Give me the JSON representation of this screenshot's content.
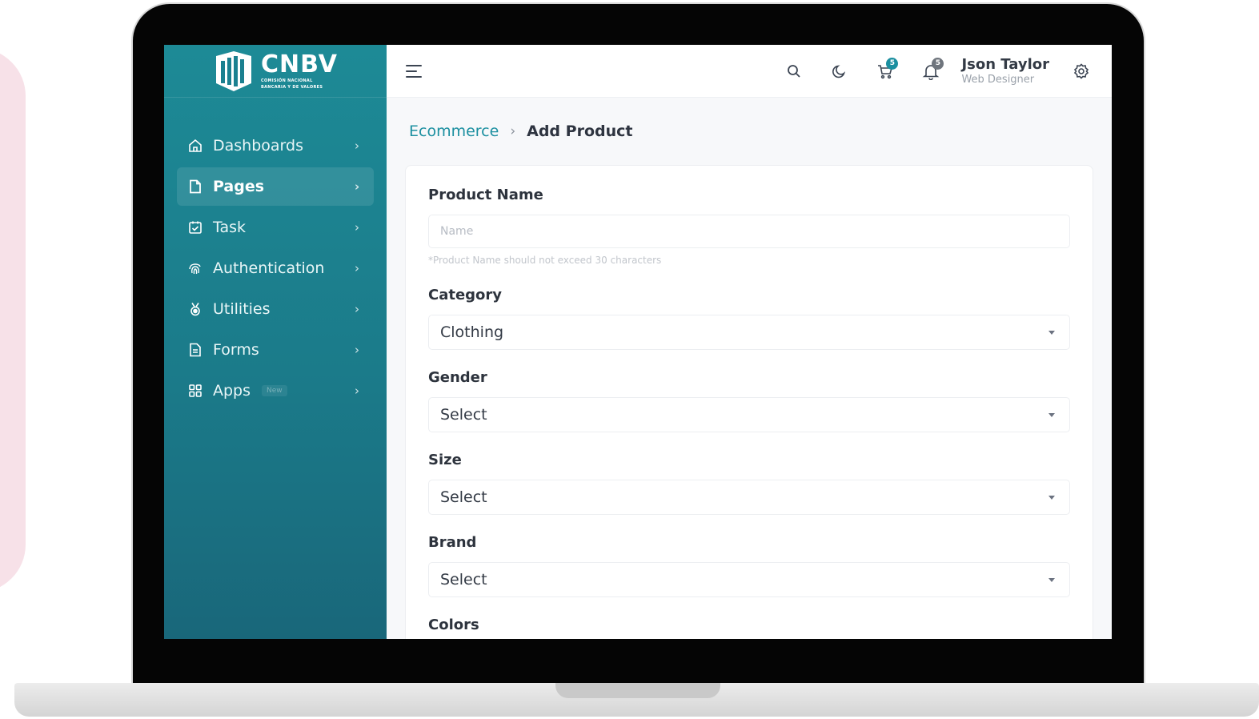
{
  "brand": {
    "name": "CNBV",
    "subtitle_line1": "COMISIÓN NACIONAL",
    "subtitle_line2": "BANCARIA Y DE VALORES"
  },
  "sidebar": {
    "items": [
      {
        "label": "Dashboards",
        "icon": "home-icon",
        "active": false
      },
      {
        "label": "Pages",
        "icon": "file-icon",
        "active": true
      },
      {
        "label": "Task",
        "icon": "task-icon",
        "active": false
      },
      {
        "label": "Authentication",
        "icon": "fingerprint-icon",
        "active": false
      },
      {
        "label": "Utilities",
        "icon": "medal-icon",
        "active": false
      },
      {
        "label": "Forms",
        "icon": "document-icon",
        "active": false
      },
      {
        "label": "Apps",
        "icon": "grid-icon",
        "active": false,
        "badge": "New"
      }
    ]
  },
  "topbar": {
    "cart_count": "5",
    "notification_count": "5",
    "user_name": "Json Taylor",
    "user_role": "Web Designer"
  },
  "breadcrumb": {
    "parent": "Ecommerce",
    "current": "Add Product"
  },
  "form": {
    "product_name_label": "Product Name",
    "product_name_placeholder": "Name",
    "product_name_help": "*Product Name should not exceed 30 characters",
    "category_label": "Category",
    "category_value": "Clothing",
    "gender_label": "Gender",
    "gender_value": "Select",
    "size_label": "Size",
    "size_value": "Select",
    "brand_label": "Brand",
    "brand_value": "Select",
    "colors_label": "Colors"
  },
  "colors": {
    "sidebar": "#1b7b8a",
    "accent": "#1b8fa0",
    "decor_panel": "#f7e1e8"
  }
}
